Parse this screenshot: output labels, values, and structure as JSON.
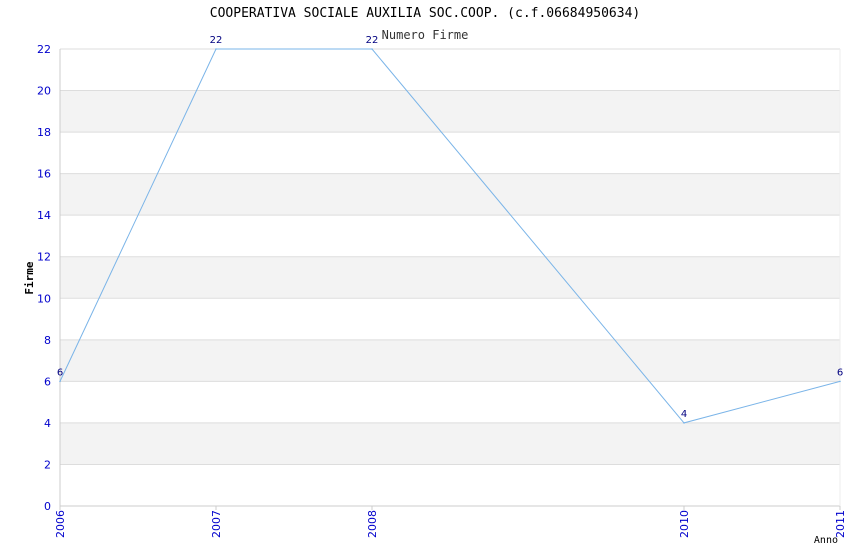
{
  "chart_data": {
    "type": "line",
    "title": "COOPERATIVA SOCIALE AUXILIA SOC.COOP. (c.f.06684950634)",
    "subtitle": "Numero Firme",
    "xlabel": "Anno",
    "ylabel": "Firme",
    "x": [
      "2006",
      "2007",
      "2008",
      "2010",
      "2011"
    ],
    "values": [
      6,
      22,
      22,
      4,
      6
    ],
    "data_labels": [
      "6",
      "22",
      "22",
      "4",
      "6"
    ],
    "y_ticks": [
      "0",
      "2",
      "4",
      "6",
      "8",
      "10",
      "12",
      "14",
      "16",
      "18",
      "20",
      "22"
    ],
    "ylim": [
      0,
      22
    ],
    "grid": true,
    "colors": {
      "line": "#7ab4e8",
      "tick_text": "#0000cc",
      "label_text": "#000080",
      "band": "#f3f3f3",
      "grid": "#dddddd"
    }
  }
}
